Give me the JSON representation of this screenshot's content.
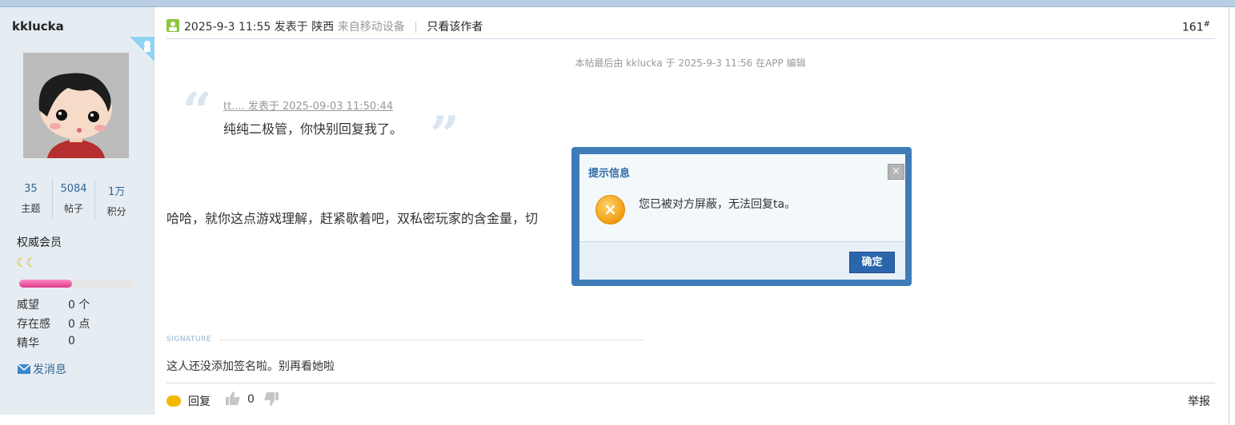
{
  "user": {
    "name": "kklucka",
    "stats": [
      {
        "value": "35",
        "label": "主题"
      },
      {
        "value": "5084",
        "label": "帖子"
      },
      {
        "value": "1万",
        "label": "积分"
      }
    ],
    "rank": "权威会员",
    "rank_icons": "☾☾",
    "credit_progress": 0.46,
    "attrs": [
      {
        "label": "威望",
        "value": "0 个"
      },
      {
        "label": "存在感",
        "value": "0 点"
      },
      {
        "label": "精华",
        "value": "0"
      }
    ],
    "send_message": "发消息"
  },
  "post": {
    "datetime": "2025-9-3 11:55",
    "posted_at": "发表于",
    "location": "陕西",
    "source": "来自移动设备",
    "separator": "|",
    "only_author": "只看该作者",
    "floor_no": "161",
    "floor_mark": "#",
    "edit_note": "本帖最后由 kklucka 于 2025-9-3 11:56 在APP 编辑",
    "quote": {
      "open_mark": "“",
      "close_mark": "”",
      "author_line": "tt.... 发表于 2025-09-03 11:50:44",
      "text": "纯纯二极管，你快别回复我了。"
    },
    "body": "哈哈，就你这点游戏理解，赶紧歇着吧，双私密玩家的含金量，切",
    "signature_label": "SIGNATURE",
    "signature": "这人还没添加签名啦。别再看她啦",
    "reply": "回复",
    "likes": "0",
    "report": "举报"
  },
  "dialog": {
    "title": "提示信息",
    "close": "×",
    "icon": "×",
    "message": "您已被对方屏蔽，无法回复ta。",
    "ok": "确定"
  },
  "colors": {
    "dialog_frame": "#3e7bb7",
    "link": "#336699",
    "sidebar_bg": "#e5edf2",
    "credit_pink": "#e0398e"
  }
}
